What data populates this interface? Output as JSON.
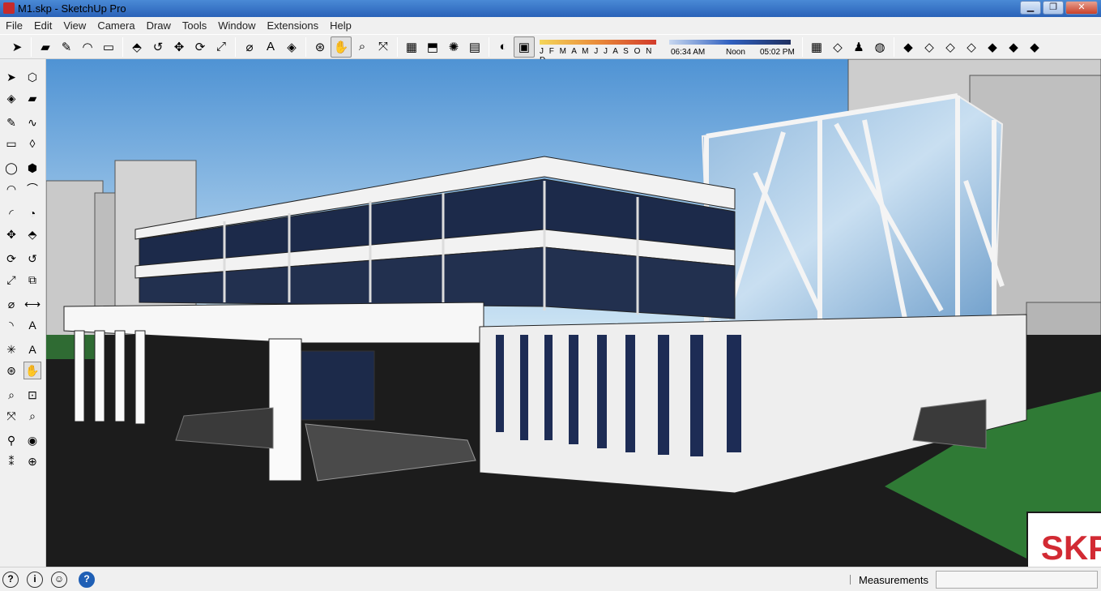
{
  "window": {
    "title": "M1.skp - SketchUp Pro",
    "minimize": "▁",
    "maximize": "❐",
    "close": "✕"
  },
  "menu": [
    "File",
    "Edit",
    "View",
    "Camera",
    "Draw",
    "Tools",
    "Window",
    "Extensions",
    "Help"
  ],
  "toolbar": {
    "months_label": "J F M A M J J A S O N D",
    "time_start": "06:34 AM",
    "time_mid": "Noon",
    "time_end": "05:02 PM",
    "buttons": [
      {
        "name": "select-tool",
        "icon": "arrow-icon",
        "glyph": "➤"
      },
      {
        "name": "eraser-tool",
        "icon": "eraser-icon",
        "glyph": "▰"
      },
      {
        "name": "pencil-tool",
        "icon": "pencil-icon",
        "glyph": "✎"
      },
      {
        "name": "arc-tool",
        "icon": "arc-icon",
        "glyph": "◠"
      },
      {
        "name": "rectangle-tool",
        "icon": "rectangle-icon",
        "glyph": "▭"
      },
      {
        "name": "push-pull-tool",
        "icon": "push-pull-icon",
        "glyph": "⬘"
      },
      {
        "name": "follow-me-tool",
        "icon": "follow-me-icon",
        "glyph": "↺"
      },
      {
        "name": "move-tool",
        "icon": "move-icon",
        "glyph": "✥"
      },
      {
        "name": "rotate-tool",
        "icon": "rotate-icon",
        "glyph": "⟳"
      },
      {
        "name": "scale-tool",
        "icon": "scale-icon",
        "glyph": "⤢"
      },
      {
        "name": "tape-measure-tool",
        "icon": "tape-icon",
        "glyph": "⌀"
      },
      {
        "name": "text-tool",
        "icon": "text-icon",
        "glyph": "A"
      },
      {
        "name": "paint-bucket-tool",
        "icon": "paint-icon",
        "glyph": "◈"
      },
      {
        "name": "orbit-tool",
        "icon": "orbit-icon",
        "glyph": "⊛"
      },
      {
        "name": "pan-tool",
        "icon": "hand-icon",
        "glyph": "✋"
      },
      {
        "name": "zoom-tool",
        "icon": "zoom-icon",
        "glyph": "⌕"
      },
      {
        "name": "zoom-extents-tool",
        "icon": "zoom-extents-icon",
        "glyph": "⤧"
      },
      {
        "name": "warehouse-button",
        "icon": "warehouse-icon",
        "glyph": "▦"
      },
      {
        "name": "share-model-button",
        "icon": "share-icon",
        "glyph": "⬒"
      },
      {
        "name": "extension-warehouse-button",
        "icon": "extension-icon",
        "glyph": "✺"
      },
      {
        "name": "layout-button",
        "icon": "layout-icon",
        "glyph": "▤"
      },
      {
        "name": "shadows-toggle",
        "icon": "shadow-icon",
        "glyph": "◐"
      },
      {
        "name": "fog-toggle",
        "icon": "fog-icon",
        "glyph": "▣"
      }
    ],
    "right_buttons": [
      {
        "name": "add-location-button",
        "icon": "location-icon",
        "glyph": "▦"
      },
      {
        "name": "toggle-terrain-button",
        "icon": "terrain-icon",
        "glyph": "◇"
      },
      {
        "name": "photo-textures-button",
        "icon": "photo-icon",
        "glyph": "♟"
      },
      {
        "name": "preview-google-earth-button",
        "icon": "globe-icon",
        "glyph": "◍"
      },
      {
        "name": "xray-style-button",
        "icon": "xray-icon",
        "glyph": "◆"
      },
      {
        "name": "back-edges-style-button",
        "icon": "back-edges-icon",
        "glyph": "◇"
      },
      {
        "name": "wireframe-style-button",
        "icon": "wireframe-icon",
        "glyph": "◇"
      },
      {
        "name": "hidden-line-style-button",
        "icon": "hidden-line-icon",
        "glyph": "◇"
      },
      {
        "name": "shaded-style-button",
        "icon": "shaded-icon",
        "glyph": "◆"
      },
      {
        "name": "shaded-textures-style-button",
        "icon": "textured-icon",
        "glyph": "◆"
      },
      {
        "name": "monochrome-style-button",
        "icon": "monochrome-icon",
        "glyph": "◆"
      }
    ]
  },
  "lefttools": [
    {
      "name": "select-tool",
      "icon": "arrow-icon",
      "glyph": "➤",
      "col": 0,
      "row": 0
    },
    {
      "name": "make-component-tool",
      "icon": "component-icon",
      "glyph": "⬡",
      "col": 1,
      "row": 0
    },
    {
      "name": "paint-bucket-tool",
      "icon": "paint-icon",
      "glyph": "◈",
      "col": 0,
      "row": 1
    },
    {
      "name": "eraser-tool",
      "icon": "eraser-icon",
      "glyph": "▰",
      "col": 1,
      "row": 1
    },
    {
      "name": "line-tool",
      "icon": "pencil-icon",
      "glyph": "✎",
      "col": 0,
      "row": 2
    },
    {
      "name": "freehand-tool",
      "icon": "freehand-icon",
      "glyph": "∿",
      "col": 1,
      "row": 2
    },
    {
      "name": "rectangle-tool",
      "icon": "rectangle-icon",
      "glyph": "▭",
      "col": 0,
      "row": 3
    },
    {
      "name": "rotated-rectangle-tool",
      "icon": "rotated-rectangle-icon",
      "glyph": "◊",
      "col": 1,
      "row": 3
    },
    {
      "name": "circle-tool",
      "icon": "circle-icon",
      "glyph": "◯",
      "col": 0,
      "row": 4
    },
    {
      "name": "polygon-tool",
      "icon": "polygon-icon",
      "glyph": "⬢",
      "col": 1,
      "row": 4
    },
    {
      "name": "arc-tool",
      "icon": "arc-icon",
      "glyph": "◠",
      "col": 0,
      "row": 5
    },
    {
      "name": "two-point-arc-tool",
      "icon": "two-point-arc-icon",
      "glyph": "⌒",
      "col": 1,
      "row": 5
    },
    {
      "name": "three-point-arc-tool",
      "icon": "three-point-arc-icon",
      "glyph": "◜",
      "col": 0,
      "row": 6
    },
    {
      "name": "pie-tool",
      "icon": "pie-icon",
      "glyph": "◔",
      "col": 1,
      "row": 6
    },
    {
      "name": "move-tool",
      "icon": "move-icon",
      "glyph": "✥",
      "col": 0,
      "row": 7
    },
    {
      "name": "push-pull-tool",
      "icon": "push-pull-icon",
      "glyph": "⬘",
      "col": 1,
      "row": 7
    },
    {
      "name": "rotate-tool",
      "icon": "rotate-icon",
      "glyph": "⟳",
      "col": 0,
      "row": 8
    },
    {
      "name": "follow-me-tool",
      "icon": "follow-me-icon",
      "glyph": "↺",
      "col": 1,
      "row": 8
    },
    {
      "name": "scale-tool",
      "icon": "scale-icon",
      "glyph": "⤢",
      "col": 0,
      "row": 9
    },
    {
      "name": "offset-tool",
      "icon": "offset-icon",
      "glyph": "⧉",
      "col": 1,
      "row": 9
    },
    {
      "name": "tape-measure-tool",
      "icon": "tape-icon",
      "glyph": "⌀",
      "col": 0,
      "row": 10
    },
    {
      "name": "dimension-tool",
      "icon": "dimension-icon",
      "glyph": "⟷",
      "col": 1,
      "row": 10
    },
    {
      "name": "protractor-tool",
      "icon": "protractor-icon",
      "glyph": "◝",
      "col": 0,
      "row": 11
    },
    {
      "name": "text-tool",
      "icon": "text-icon",
      "glyph": "A",
      "col": 1,
      "row": 11
    },
    {
      "name": "axes-tool",
      "icon": "axes-icon",
      "glyph": "✳",
      "col": 0,
      "row": 12
    },
    {
      "name": "3d-text-tool",
      "icon": "3d-text-icon",
      "glyph": "A",
      "col": 1,
      "row": 12
    },
    {
      "name": "orbit-tool",
      "icon": "orbit-icon",
      "glyph": "⊛",
      "col": 0,
      "row": 13
    },
    {
      "name": "pan-tool",
      "icon": "hand-icon",
      "glyph": "✋",
      "col": 1,
      "row": 13
    },
    {
      "name": "zoom-tool",
      "icon": "zoom-icon",
      "glyph": "⌕",
      "col": 0,
      "row": 14
    },
    {
      "name": "zoom-window-tool",
      "icon": "zoom-window-icon",
      "glyph": "⊡",
      "col": 1,
      "row": 14
    },
    {
      "name": "zoom-extents-tool",
      "icon": "zoom-extents-icon",
      "glyph": "⤧",
      "col": 0,
      "row": 15
    },
    {
      "name": "previous-view-tool",
      "icon": "previous-view-icon",
      "glyph": "⌕",
      "col": 1,
      "row": 15
    },
    {
      "name": "position-camera-tool",
      "icon": "camera-icon",
      "glyph": "⚲",
      "col": 0,
      "row": 16
    },
    {
      "name": "look-around-tool",
      "icon": "eye-icon",
      "glyph": "◉",
      "col": 1,
      "row": 16
    },
    {
      "name": "walk-tool",
      "icon": "footprints-icon",
      "glyph": "⁑",
      "col": 0,
      "row": 17
    },
    {
      "name": "section-plane-tool",
      "icon": "section-icon",
      "glyph": "⊕",
      "col": 1,
      "row": 17
    }
  ],
  "status": {
    "measurements_label": "Measurements",
    "measurements_value": ""
  },
  "badge": {
    "text": "SKP"
  },
  "colors": {
    "sky_top": "#4f93d4",
    "sky_bottom": "#d6eaf6",
    "ground": "#1c1c1c",
    "lawn": "#2f7a35",
    "badge_text": "#d22a33"
  }
}
